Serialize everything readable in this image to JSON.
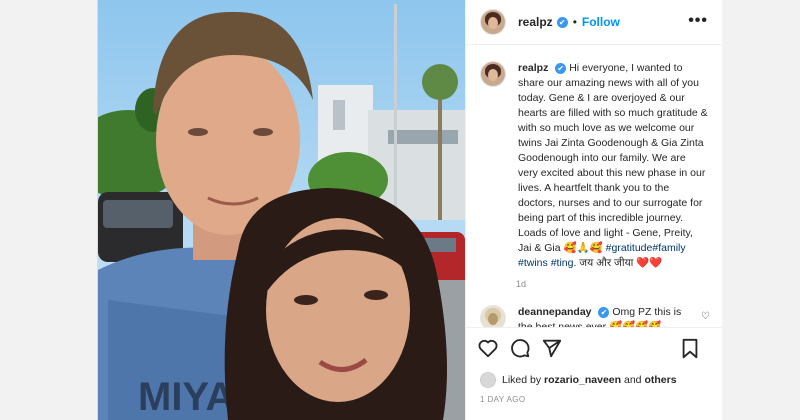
{
  "header": {
    "username": "realpz",
    "verified": "✔",
    "separator": "•",
    "follow_label": "Follow",
    "more_label": "•••"
  },
  "caption": {
    "username": "realpz",
    "text_1": "Hi everyone, I wanted to share our amazing news with all of you today. Gene & I are overjoyed & our hearts are filled with so much gratitude & with so much love as we welcome our twins Jai Zinta Goodenough & Gia Zinta Goodenough into our family. We are very excited about this new phase in our lives. A heartfelt thank you to the doctors, nurses and to our surrogate for being part of this incredible journey. Loads of love and light - Gene, Preity, Jai & Gia 🥰🙏🥰 ",
    "hashtag_1": "#gratitude",
    "hashtag_2": "#family",
    "hashtag_3": "#twins",
    "hashtag_4": "#ting",
    "text_2": ". जय और जीया ",
    "hearts": "❤️❤️",
    "time": "1d"
  },
  "comment": {
    "username": "deannepanday",
    "text": "Omg PZ this is the best news ever 🥰🥰🥰🥰"
  },
  "likes": {
    "prefix": "Liked by ",
    "user": "rozario_naveen",
    "middle": " and ",
    "others": "others"
  },
  "timestamp": "1 DAY AGO",
  "colors": {
    "link": "#0095f6",
    "hashtag": "#00376b",
    "verified": "#3897f0"
  },
  "icons": [
    "heart-icon",
    "comment-icon",
    "share-icon",
    "bookmark-icon",
    "more-icon"
  ]
}
